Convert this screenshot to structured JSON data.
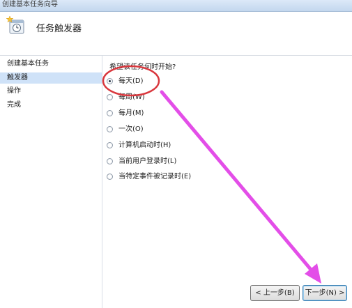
{
  "window": {
    "title": "创建基本任务向导"
  },
  "header": {
    "icon": "task-scheduler-clock-icon",
    "title": "任务触发器"
  },
  "sidebar": {
    "items": [
      {
        "label": "创建基本任务",
        "selected": false
      },
      {
        "label": "触发器",
        "selected": true
      },
      {
        "label": "操作",
        "selected": false
      },
      {
        "label": "完成",
        "selected": false
      }
    ]
  },
  "main": {
    "question": "希望该任务何时开始?",
    "options": [
      {
        "label": "每天(D)",
        "checked": true
      },
      {
        "label": "每周(W)",
        "checked": false
      },
      {
        "label": "每月(M)",
        "checked": false
      },
      {
        "label": "一次(O)",
        "checked": false
      },
      {
        "label": "计算机启动时(H)",
        "checked": false
      },
      {
        "label": "当前用户登录时(L)",
        "checked": false
      },
      {
        "label": "当特定事件被记录时(E)",
        "checked": false
      }
    ]
  },
  "buttons": {
    "back": "< 上一步(B)",
    "next": "下一步(N) >"
  },
  "annotations": {
    "highlight_color": "#d9373d",
    "arrow_color": "#e34ee8"
  }
}
